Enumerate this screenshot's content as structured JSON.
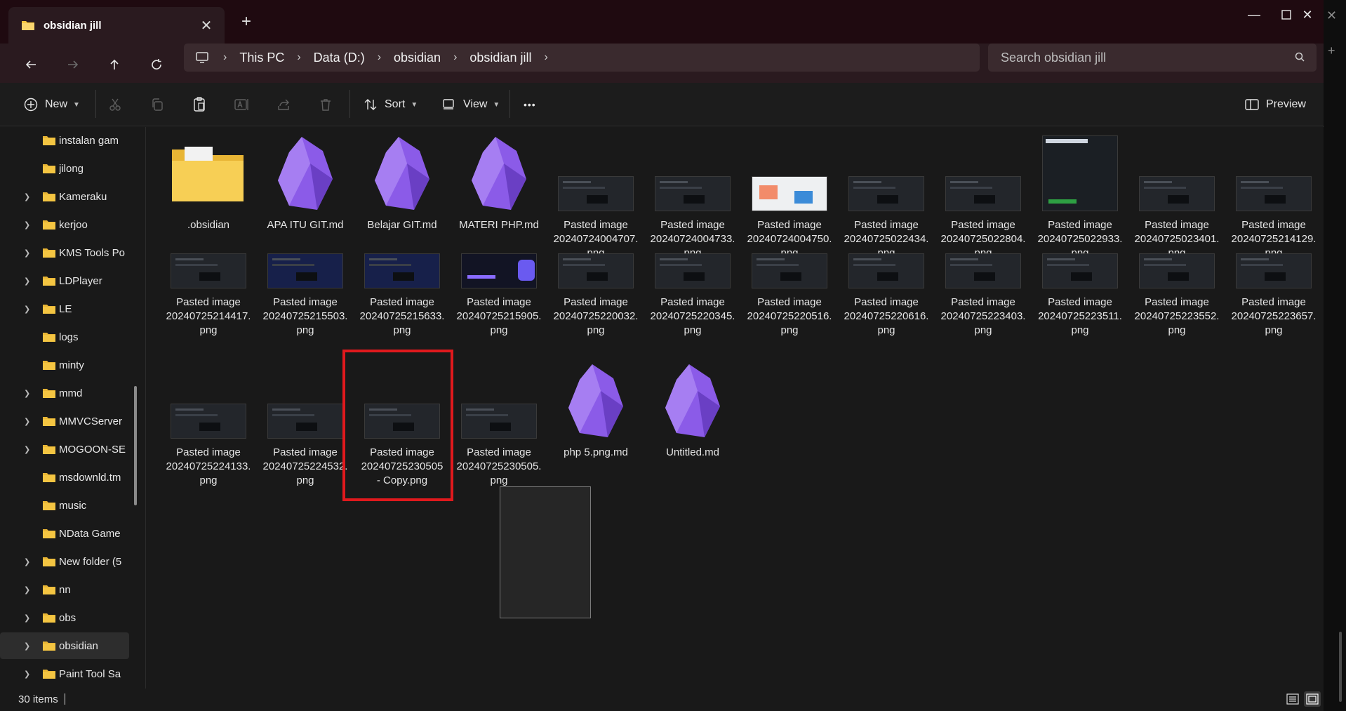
{
  "window": {
    "tab_title": "obsidian jill",
    "new_tab": "+",
    "controls": {
      "minimize": "—",
      "maximize": "☐",
      "close": "✕"
    }
  },
  "nav": {
    "breadcrumbs": [
      "This PC",
      "Data (D:)",
      "obsidian",
      "obsidian jill"
    ],
    "search_placeholder": "Search obsidian jill"
  },
  "toolbar": {
    "new_label": "New",
    "sort_label": "Sort",
    "view_label": "View",
    "more_label": "•••",
    "preview_label": "Preview"
  },
  "sidebar": {
    "items": [
      {
        "label": "instalan gam",
        "expandable": false,
        "selected": false
      },
      {
        "label": "jilong",
        "expandable": false,
        "selected": false
      },
      {
        "label": "Kameraku",
        "expandable": true,
        "selected": false
      },
      {
        "label": "kerjoo",
        "expandable": true,
        "selected": false
      },
      {
        "label": "KMS Tools Po",
        "expandable": true,
        "selected": false
      },
      {
        "label": "LDPlayer",
        "expandable": true,
        "selected": false
      },
      {
        "label": "LE",
        "expandable": true,
        "selected": false
      },
      {
        "label": "logs",
        "expandable": false,
        "selected": false
      },
      {
        "label": "minty",
        "expandable": false,
        "selected": false
      },
      {
        "label": "mmd",
        "expandable": true,
        "selected": false
      },
      {
        "label": "MMVCServer",
        "expandable": true,
        "selected": false
      },
      {
        "label": "MOGOON-SE",
        "expandable": true,
        "selected": false
      },
      {
        "label": "msdownld.tm",
        "expandable": false,
        "selected": false
      },
      {
        "label": "music",
        "expandable": false,
        "selected": false
      },
      {
        "label": "NData Game",
        "expandable": false,
        "selected": false
      },
      {
        "label": "New folder (5",
        "expandable": true,
        "selected": false
      },
      {
        "label": "nn",
        "expandable": true,
        "selected": false
      },
      {
        "label": "obs",
        "expandable": true,
        "selected": false
      },
      {
        "label": "obsidian",
        "expandable": true,
        "selected": true
      },
      {
        "label": "Paint Tool Sa",
        "expandable": true,
        "selected": false
      }
    ]
  },
  "files": [
    {
      "line1": ".obsidian",
      "line2": "",
      "line3": "",
      "kind": "folder"
    },
    {
      "line1": "APA ITU GIT.md",
      "line2": "",
      "line3": "",
      "kind": "obsidian"
    },
    {
      "line1": "Belajar GIT.md",
      "line2": "",
      "line3": "",
      "kind": "obsidian"
    },
    {
      "line1": "MATERI PHP.md",
      "line2": "",
      "line3": "",
      "kind": "obsidian"
    },
    {
      "line1": "Pasted image",
      "line2": "20240724004707.",
      "line3": "png",
      "kind": "shot"
    },
    {
      "line1": "Pasted image",
      "line2": "20240724004733.",
      "line3": "png",
      "kind": "shot"
    },
    {
      "line1": "Pasted image",
      "line2": "20240724004750.",
      "line3": "png",
      "kind": "shot-light"
    },
    {
      "line1": "Pasted image",
      "line2": "20240725022434.",
      "line3": "png",
      "kind": "shot"
    },
    {
      "line1": "Pasted image",
      "line2": "20240725022804.",
      "line3": "png",
      "kind": "shot"
    },
    {
      "line1": "Pasted image",
      "line2": "20240725022933.",
      "line3": "png",
      "kind": "shot-tall"
    },
    {
      "line1": "Pasted image",
      "line2": "20240725023401.",
      "line3": "png",
      "kind": "shot"
    },
    {
      "line1": "Pasted image",
      "line2": "20240725214129.",
      "line3": "png",
      "kind": "shot"
    },
    {
      "line1": "Pasted image",
      "line2": "20240725214417.",
      "line3": "png",
      "kind": "shot"
    },
    {
      "line1": "Pasted image",
      "line2": "20240725215503.",
      "line3": "png",
      "kind": "shot-blue"
    },
    {
      "line1": "Pasted image",
      "line2": "20240725215633.",
      "line3": "png",
      "kind": "shot-blue"
    },
    {
      "line1": "Pasted image",
      "line2": "20240725215905.",
      "line3": "png",
      "kind": "shot-purple"
    },
    {
      "line1": "Pasted image",
      "line2": "20240725220032.",
      "line3": "png",
      "kind": "shot"
    },
    {
      "line1": "Pasted image",
      "line2": "20240725220345.",
      "line3": "png",
      "kind": "shot"
    },
    {
      "line1": "Pasted image",
      "line2": "20240725220516.",
      "line3": "png",
      "kind": "shot"
    },
    {
      "line1": "Pasted image",
      "line2": "20240725220616.",
      "line3": "png",
      "kind": "shot"
    },
    {
      "line1": "Pasted image",
      "line2": "20240725223403.",
      "line3": "png",
      "kind": "shot"
    },
    {
      "line1": "Pasted image",
      "line2": "20240725223511.",
      "line3": "png",
      "kind": "shot"
    },
    {
      "line1": "Pasted image",
      "line2": "20240725223552.",
      "line3": "png",
      "kind": "shot"
    },
    {
      "line1": "Pasted image",
      "line2": "20240725223657.",
      "line3": "png",
      "kind": "shot"
    },
    {
      "line1": "Pasted image",
      "line2": "20240725224133.",
      "line3": "png",
      "kind": "shot"
    },
    {
      "line1": "Pasted image",
      "line2": "20240725224532.",
      "line3": "png",
      "kind": "shot"
    },
    {
      "line1": "Pasted image",
      "line2": "20240725230505",
      "line3": "- Copy.png",
      "kind": "shot",
      "selected": true
    },
    {
      "line1": "Pasted image",
      "line2": "20240725230505.",
      "line3": "png",
      "kind": "shot"
    },
    {
      "line1": "php 5.png.md",
      "line2": "",
      "line3": "",
      "kind": "obsidian"
    },
    {
      "line1": "Untitled.md",
      "line2": "",
      "line3": "",
      "kind": "obsidian"
    }
  ],
  "status": {
    "item_count": "30 items"
  },
  "colors": {
    "titlebar": "#1f0a10",
    "accent_highlight": "#e0191d",
    "folder_yellow": "#f4c542",
    "obsidian_purple": "#7b4fd6"
  }
}
